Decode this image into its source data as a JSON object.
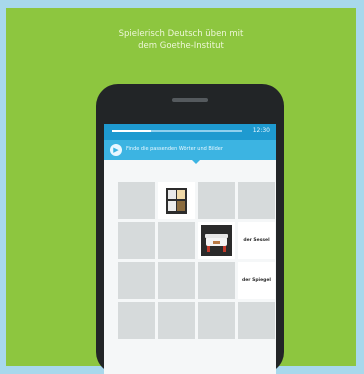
{
  "promo": {
    "headline_line1": "Spielerisch Deutsch üben mit",
    "headline_line2": "dem Goethe-Institut"
  },
  "app": {
    "status_time": "12:30",
    "progress": 0.3,
    "instruction": "Finde die passenden Wörter und Bilder",
    "cards": [
      {
        "state": "hidden"
      },
      {
        "state": "image",
        "icon": "bookshelf-icon"
      },
      {
        "state": "hidden"
      },
      {
        "state": "hidden"
      },
      {
        "state": "hidden"
      },
      {
        "state": "hidden"
      },
      {
        "state": "image",
        "icon": "sofa-icon"
      },
      {
        "state": "word",
        "word": "der Sessel"
      },
      {
        "state": "hidden"
      },
      {
        "state": "hidden"
      },
      {
        "state": "hidden"
      },
      {
        "state": "word",
        "word": "der Spiegel"
      },
      {
        "state": "hidden"
      },
      {
        "state": "hidden"
      },
      {
        "state": "hidden"
      },
      {
        "state": "hidden"
      }
    ]
  },
  "colors": {
    "background": "#8dc63f",
    "accent": "#3cb4e2",
    "card_back": "#d6dadb"
  }
}
